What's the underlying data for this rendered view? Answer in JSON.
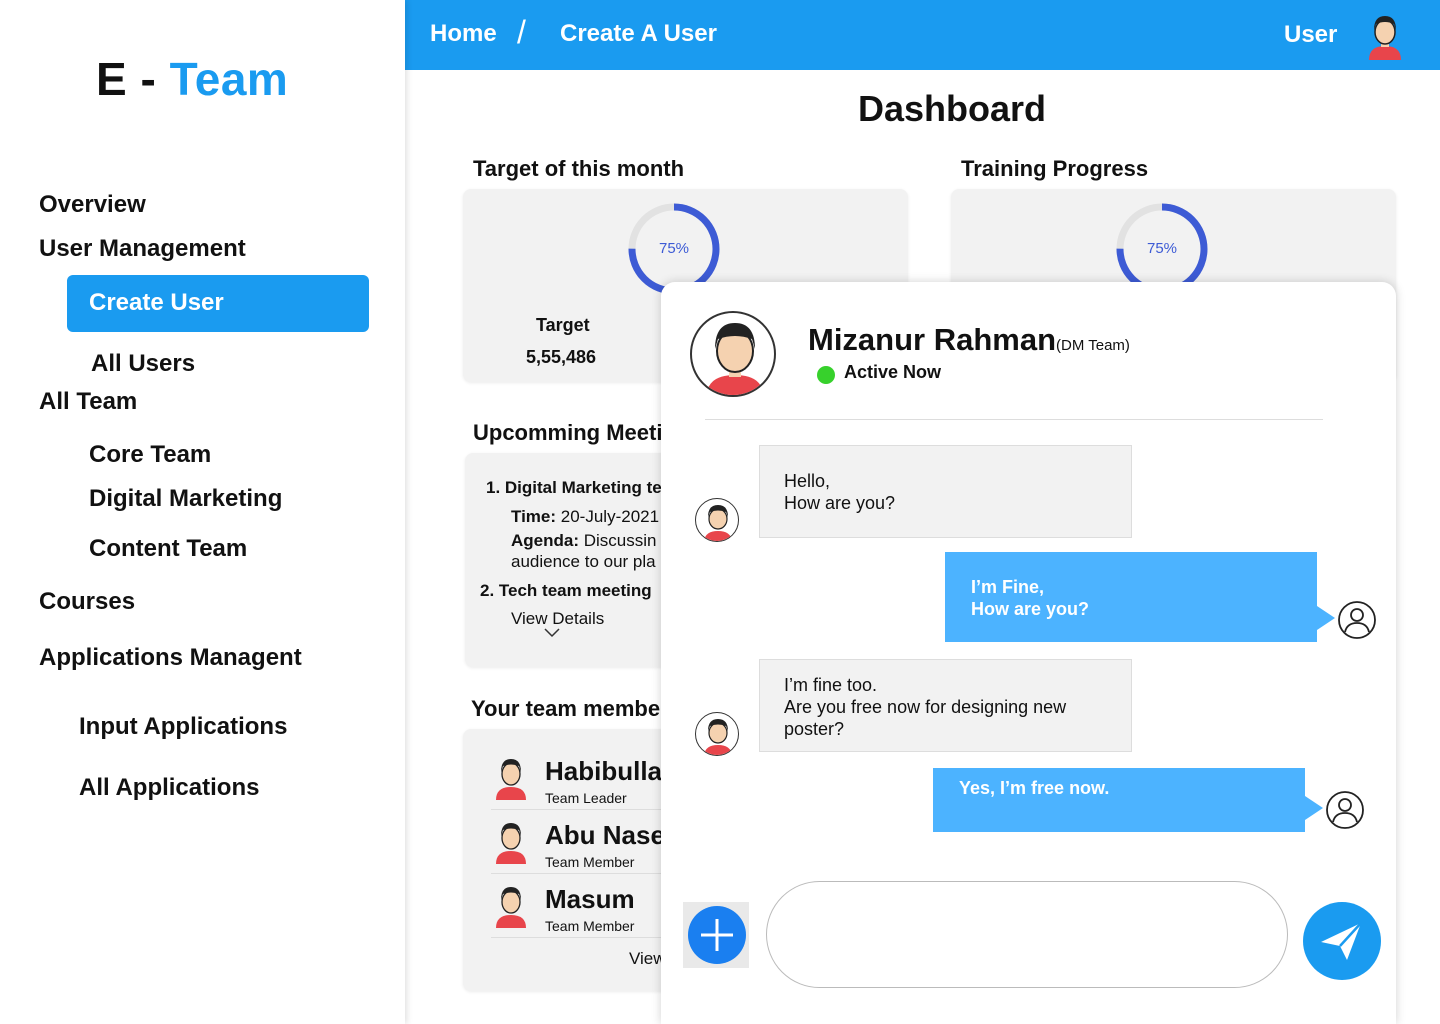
{
  "brand": {
    "prefix": "E",
    "dash": "-",
    "suffix": "Team"
  },
  "sidebar": {
    "overview": "Overview",
    "user_management": "User Management",
    "create_user": "Create User",
    "all_users": "All Users",
    "all_team": "All Team",
    "core_team": "Core Team",
    "digital_marketing": "Digital Marketing",
    "content_team": "Content Team",
    "courses": "Courses",
    "applications_management": "Applications Managent",
    "input_applications": "Input Applications",
    "all_applications": "All Applications"
  },
  "topbar": {
    "breadcrumb_home": "Home",
    "breadcrumb_sep": "/",
    "breadcrumb_current": "Create A User",
    "user_label": "User"
  },
  "page_title": "Dashboard",
  "target": {
    "title": "Target of this month",
    "progress_label": "75%",
    "progress": 0.75,
    "label": "Target",
    "value": "5,55,486"
  },
  "training": {
    "title": "Training Progress",
    "progress_label": "75%",
    "progress": 0.75
  },
  "meetings": {
    "title": "Upcomming Meetir",
    "item1_title": "1.  Digital Marketing te",
    "item1_time_label": "Time:",
    "item1_time_value": " 20-July-2021",
    "item1_agenda_label": "Agenda:",
    "item1_agenda_value": " Discussin",
    "item1_agenda_line2": "audience to our pla",
    "item2_title": "2. Tech team meeting",
    "view_details": "View Details"
  },
  "team": {
    "title": "Your team member",
    "members": [
      {
        "name": "Habibullah",
        "role": "Team Leader"
      },
      {
        "name": "Abu Naser",
        "role": "Team Member"
      },
      {
        "name": "Masum",
        "role": "Team Member"
      }
    ],
    "view_label": "View"
  },
  "chat": {
    "contact_name": "Mizanur Rahman",
    "contact_team": "(DM Team)",
    "status": "Active  Now",
    "status_color": "#37d12c",
    "messages": [
      {
        "from": "them",
        "line1": "Hello,",
        "line2": "How are you?",
        "line3": ""
      },
      {
        "from": "me",
        "line1": "I’m Fine,",
        "line2": "How are you?",
        "line3": ""
      },
      {
        "from": "them",
        "line1": "I’m fine too.",
        "line2": "Are you free now for designing new",
        "line3": "poster?"
      },
      {
        "from": "me",
        "line1": "Yes, I’m free now.",
        "line2": "",
        "line3": ""
      }
    ],
    "input_placeholder": ""
  },
  "colors": {
    "accent": "#1a9bf0",
    "bubble_out": "#4cb3ff",
    "donut": "#3d5bd5"
  },
  "icons": [
    "user-avatar-icon",
    "plus-icon",
    "send-icon",
    "user-outline-icon",
    "chevron-down-icon"
  ]
}
